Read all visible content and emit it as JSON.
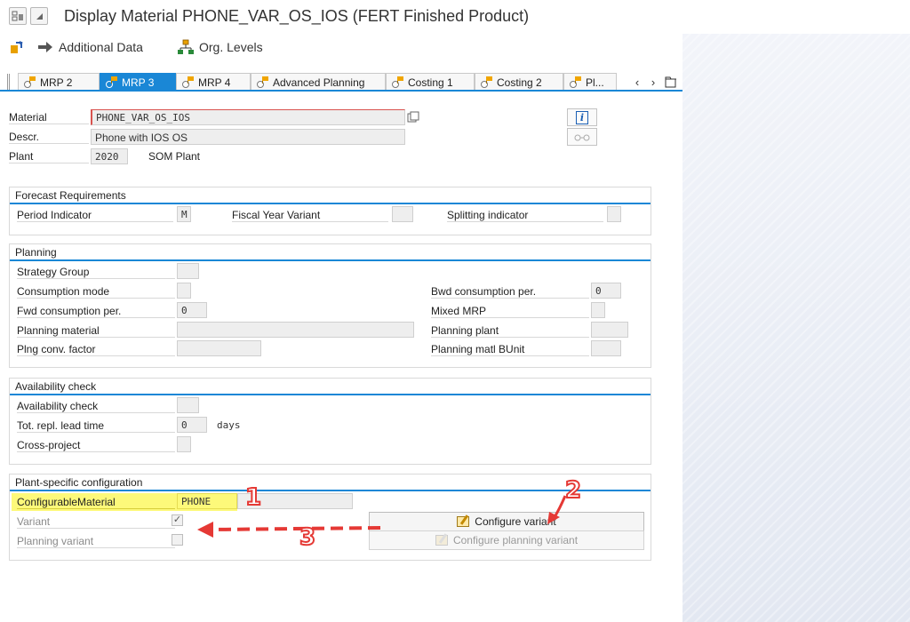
{
  "window": {
    "title": "Display Material PHONE_VAR_OS_IOS (FERT Finished Product)"
  },
  "appbar": {
    "additional_data": "Additional Data",
    "org_levels": "Org. Levels"
  },
  "tabs": [
    {
      "label": "MRP 2",
      "active": false
    },
    {
      "label": "MRP 3",
      "active": true
    },
    {
      "label": "MRP 4",
      "active": false
    },
    {
      "label": "Advanced Planning",
      "active": false
    },
    {
      "label": "Costing 1",
      "active": false
    },
    {
      "label": "Costing 2",
      "active": false
    },
    {
      "label": "Pl...",
      "active": false
    }
  ],
  "tab_nav": {
    "prev": "‹",
    "next": "›"
  },
  "header": {
    "material_label": "Material",
    "material_value": "PHONE_VAR_OS_IOS",
    "descr_label": "Descr.",
    "descr_value": "Phone with IOS OS",
    "plant_label": "Plant",
    "plant_value": "2020",
    "plant_name": "SOM Plant",
    "info_glyph": "i",
    "glasses_glyph": "👓"
  },
  "forecast": {
    "title": "Forecast Requirements",
    "period_indicator_label": "Period Indicator",
    "period_indicator_value": "M",
    "fiscal_year_variant_label": "Fiscal Year Variant",
    "fiscal_year_variant_value": "",
    "splitting_indicator_label": "Splitting indicator",
    "splitting_indicator_value": ""
  },
  "planning": {
    "title": "Planning",
    "strategy_group_label": "Strategy Group",
    "consumption_mode_label": "Consumption mode",
    "fwd_consumption_label": "Fwd consumption per.",
    "fwd_consumption_value": "0",
    "planning_material_label": "Planning material",
    "plng_conv_factor_label": "Plng conv. factor",
    "bwd_consumption_label": "Bwd consumption per.",
    "bwd_consumption_value": "0",
    "mixed_mrp_label": "Mixed MRP",
    "planning_plant_label": "Planning plant",
    "planning_matl_bunit_label": "Planning matl BUnit"
  },
  "availability": {
    "title": "Availability check",
    "availability_check_label": "Availability check",
    "tot_repl_lead_time_label": "Tot. repl. lead time",
    "tot_repl_lead_time_value": "0",
    "days_unit": "days",
    "cross_project_label": "Cross-project"
  },
  "plant_config": {
    "title": "Plant-specific configuration",
    "configurable_material_label": "ConfigurableMaterial",
    "configurable_material_value": "PHONE",
    "variant_label": "Variant",
    "variant_checked": true,
    "variant_mark": "✓",
    "planning_variant_label": "Planning variant",
    "planning_variant_checked": false,
    "configure_variant_label": "Configure variant",
    "configure_planning_variant_label": "Configure planning variant"
  },
  "annotations": {
    "one": "1",
    "two": "2",
    "three": "3",
    "color": "#e53935"
  },
  "colors": {
    "accent": "#1a87d6",
    "highlight": "#fdf97a"
  }
}
